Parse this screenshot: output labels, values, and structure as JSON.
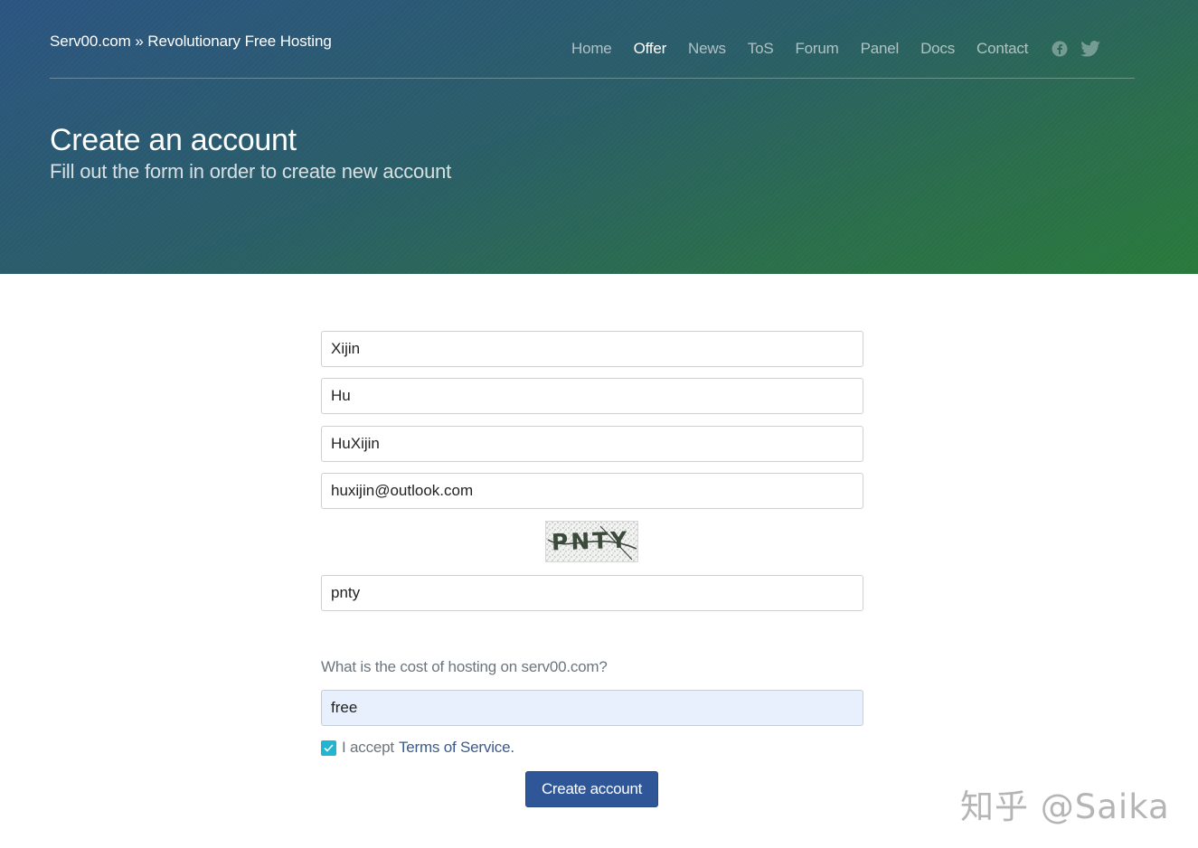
{
  "header": {
    "brand": "Serv00.com » Revolutionary Free Hosting",
    "nav": [
      {
        "label": "Home",
        "active": false
      },
      {
        "label": "Offer",
        "active": true
      },
      {
        "label": "News",
        "active": false
      },
      {
        "label": "ToS",
        "active": false
      },
      {
        "label": "Forum",
        "active": false
      },
      {
        "label": "Panel",
        "active": false
      },
      {
        "label": "Docs",
        "active": false
      },
      {
        "label": "Contact",
        "active": false
      }
    ],
    "social": [
      "facebook-icon",
      "twitter-icon"
    ],
    "title": "Create an account",
    "subtitle": "Fill out the form in order to create new account"
  },
  "form": {
    "first_name": "Xijin",
    "last_name": "Hu",
    "username": "HuXijin",
    "email": "huxijin@outlook.com",
    "captcha_image_text": "PNTY",
    "captcha_answer": "pnty",
    "question": "What is the cost of hosting on serv00.com?",
    "question_answer": "free",
    "accept_text": "I accept",
    "tos_link": "Terms of Service.",
    "tos_checked": true,
    "submit_label": "Create account"
  },
  "watermark": "知乎 @Saika",
  "colors": {
    "hero_start": "#2c5582",
    "hero_end": "#2a7a3c",
    "button": "#2f5697",
    "checkbox": "#21b5cf",
    "link": "#3b5a8c"
  }
}
